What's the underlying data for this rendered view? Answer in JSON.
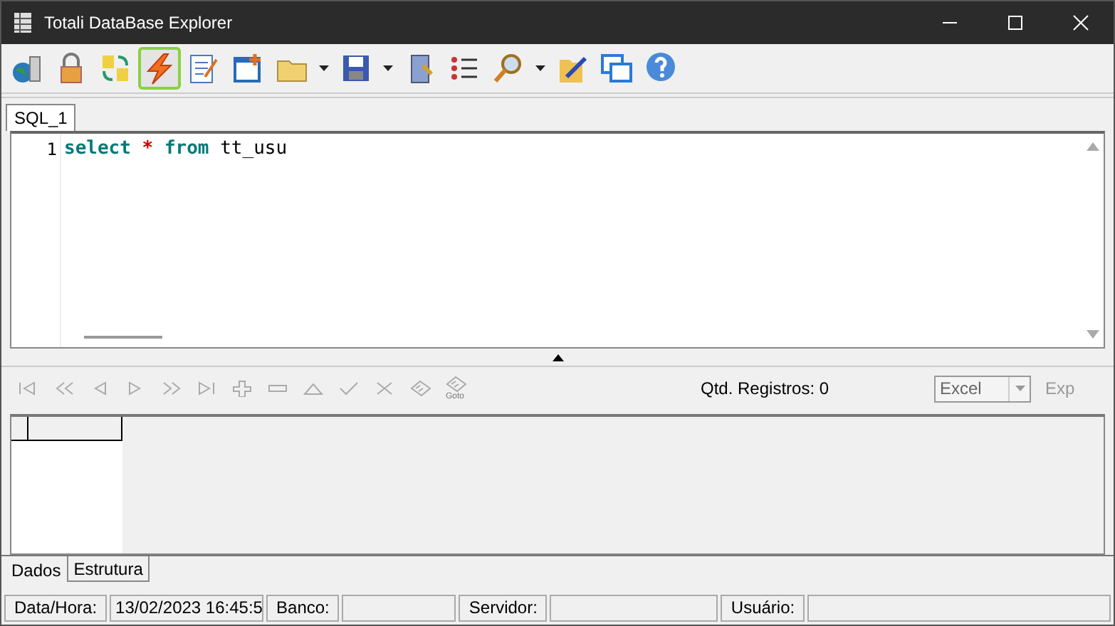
{
  "window": {
    "title": "Totali DataBase Explorer"
  },
  "toolbar": {
    "tools": [
      {
        "kind": "button",
        "selected": false
      },
      {
        "kind": "button",
        "selected": false
      },
      {
        "kind": "button",
        "selected": false
      },
      {
        "kind": "button",
        "selected": true
      },
      {
        "kind": "button",
        "selected": false
      },
      {
        "kind": "button",
        "selected": false
      },
      {
        "kind": "button",
        "selected": false
      },
      {
        "kind": "dropdown"
      },
      {
        "kind": "button",
        "selected": false
      },
      {
        "kind": "dropdown"
      },
      {
        "kind": "button",
        "selected": false
      },
      {
        "kind": "button",
        "selected": false
      },
      {
        "kind": "button",
        "selected": false
      },
      {
        "kind": "dropdown"
      },
      {
        "kind": "button",
        "selected": false
      },
      {
        "kind": "button",
        "selected": false
      },
      {
        "kind": "button",
        "selected": false
      }
    ]
  },
  "editor_tabs": [
    {
      "label": "SQL_1",
      "selected": true
    }
  ],
  "editor": {
    "lines": [
      {
        "number": "1",
        "tokens": [
          {
            "kind": "keyword",
            "text": "select"
          },
          {
            "kind": "operator",
            "text": "*"
          },
          {
            "kind": "keyword",
            "text": "from"
          },
          {
            "kind": "ident",
            "text": "tt_usu"
          }
        ]
      }
    ]
  },
  "navigator": {
    "buttons": [
      {
        "disabled": true
      },
      {
        "disabled": true
      },
      {
        "disabled": true
      },
      {
        "disabled": true
      },
      {
        "disabled": true
      },
      {
        "disabled": true
      },
      {
        "disabled": true
      },
      {
        "disabled": true
      },
      {
        "disabled": true
      },
      {
        "disabled": true
      },
      {
        "disabled": true
      },
      {
        "disabled": true
      },
      {
        "disabled": true,
        "caption": "Goto"
      }
    ],
    "record_count": "Qtd. Registros: 0",
    "export_format": "Excel",
    "export_button": {
      "label": "Exp",
      "disabled": true
    }
  },
  "result_tabs": [
    {
      "label": "Dados",
      "selected": true
    },
    {
      "label": "Estrutura",
      "selected": false
    }
  ],
  "status_bar": [
    {
      "label": "Data/Hora:",
      "value": "13/02/2023 16:45:5"
    },
    {
      "label": "Banco:"
    },
    {
      "label": "Servidor:"
    },
    {
      "label": "Usuário:"
    }
  ]
}
